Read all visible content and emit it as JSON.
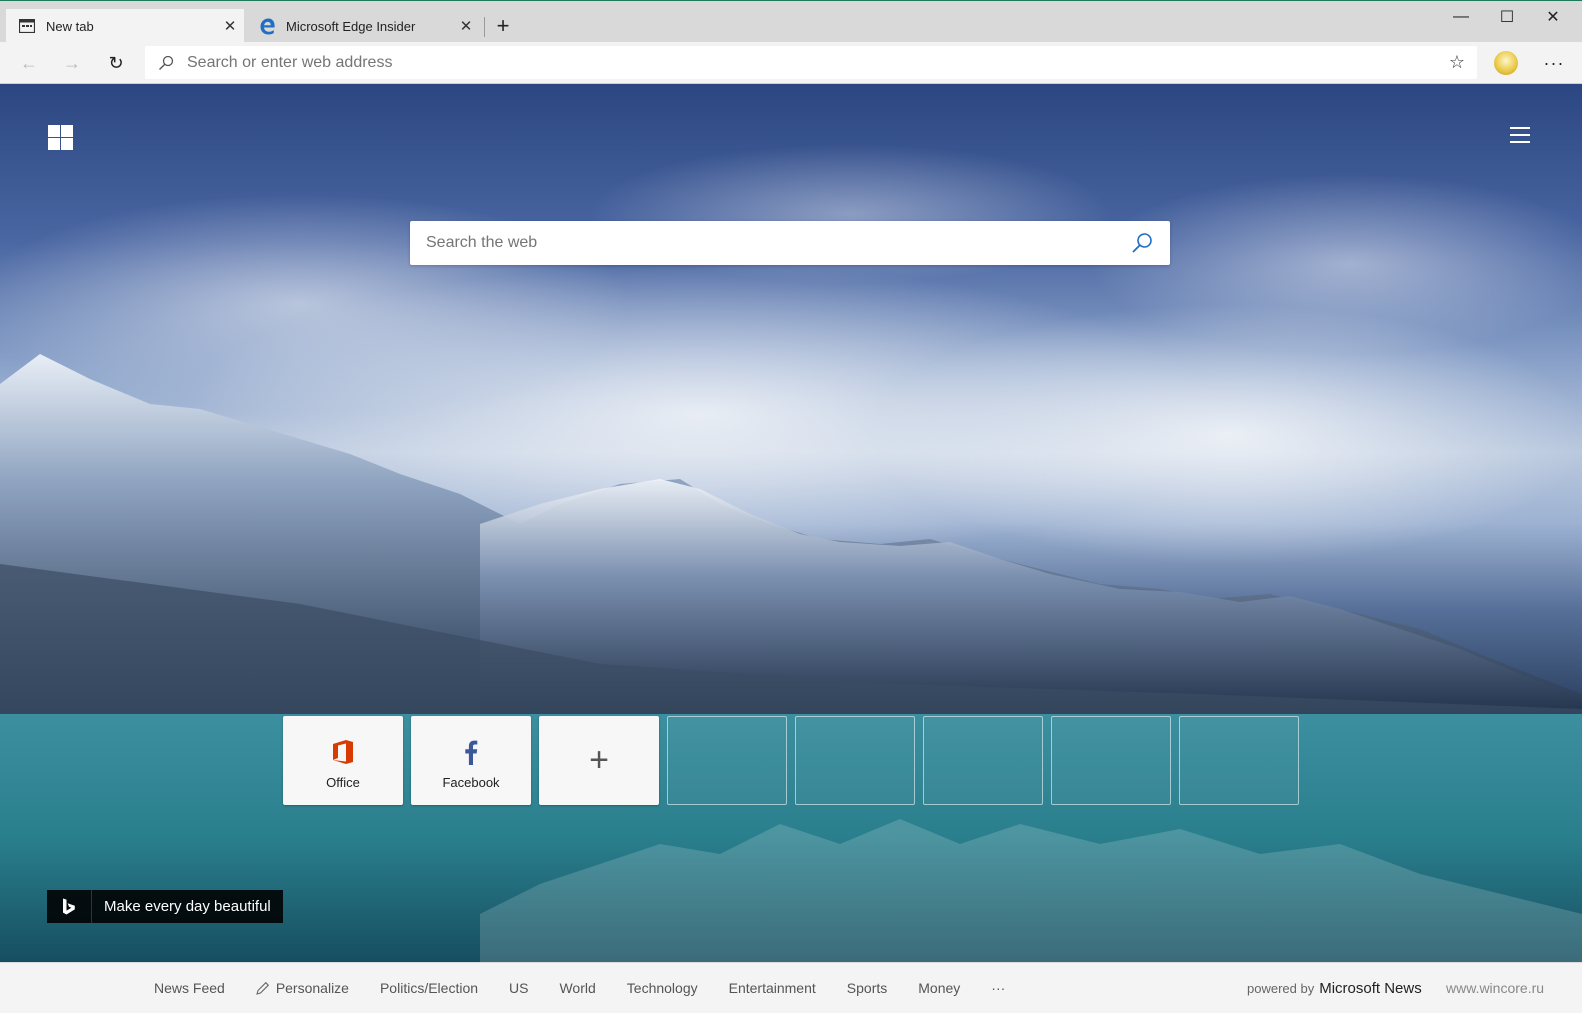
{
  "tabs": [
    {
      "title": "New tab",
      "icon": "newtab-page-icon",
      "active": true
    },
    {
      "title": "Microsoft Edge Insider",
      "icon": "edge-logo-icon",
      "active": false
    }
  ],
  "window_controls": {
    "minimize": "—",
    "maximize": "☐",
    "close": "✕"
  },
  "toolbar": {
    "back": "←",
    "forward": "→",
    "refresh": "↻",
    "address_placeholder": "Search or enter web address",
    "favorite": "☆",
    "more": "···"
  },
  "newtab": {
    "search_placeholder": "Search the web",
    "tiles": [
      {
        "label": "Office",
        "icon": "office-logo-icon",
        "color": "#d83b01"
      },
      {
        "label": "Facebook",
        "icon": "facebook-logo-icon",
        "color": "#3b5998"
      },
      {
        "label": "+",
        "icon": "add-site-icon"
      }
    ],
    "empty_tile_count": 5,
    "bing_caption": "Make every day beautiful"
  },
  "news": {
    "items": [
      "News Feed",
      "Personalize",
      "Politics/Election",
      "US",
      "World",
      "Technology",
      "Entertainment",
      "Sports",
      "Money"
    ],
    "more": "···",
    "powered_by": "powered by",
    "brand": "Microsoft News"
  },
  "watermark": "www.wincore.ru",
  "colors": {
    "accent": "#0078d7",
    "office": "#d83b01",
    "facebook": "#3b5998"
  }
}
